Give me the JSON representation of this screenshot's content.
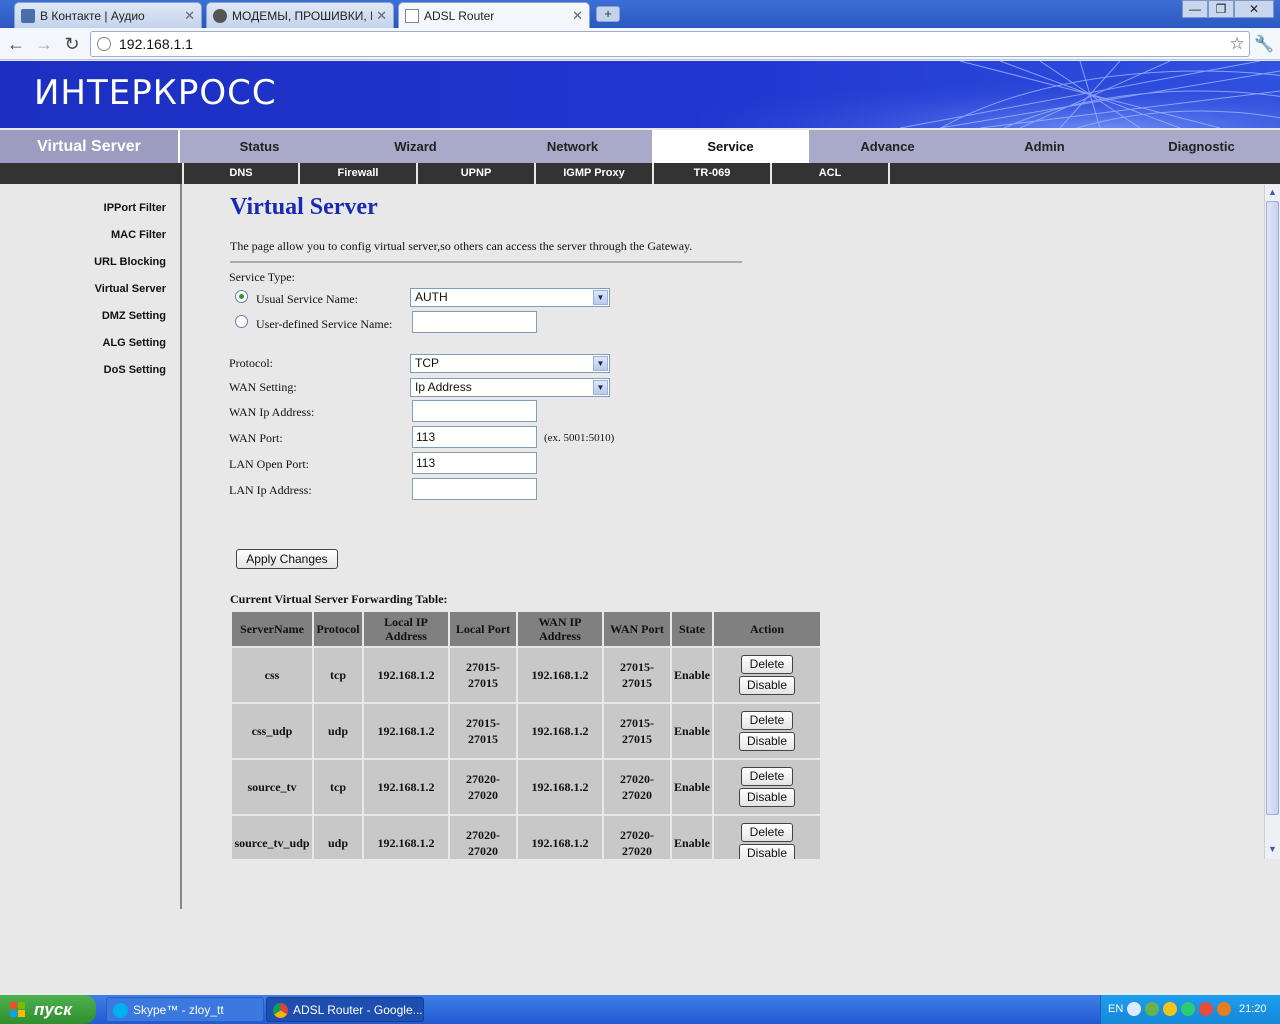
{
  "browser": {
    "tabs": [
      {
        "label": "В Контакте | Аудио",
        "active": false
      },
      {
        "label": "МОДЕМЫ, ПРОШИВКИ, И...",
        "active": false
      },
      {
        "label": "ADSL Router",
        "active": true
      }
    ],
    "url": "192.168.1.1"
  },
  "router": {
    "logo": "ИНТЕРКРОСС",
    "section_title": "Virtual Server",
    "main_menu": [
      "Status",
      "Wizard",
      "Network",
      "Service",
      "Advance",
      "Admin",
      "Diagnostic"
    ],
    "main_menu_active": "Service",
    "sub_menu": [
      "DNS",
      "Firewall",
      "UPNP",
      "IGMP Proxy",
      "TR-069",
      "ACL"
    ],
    "sidebar": [
      "IPPort Filter",
      "MAC Filter",
      "URL Blocking",
      "Virtual Server",
      "DMZ Setting",
      "ALG Setting",
      "DoS Setting"
    ]
  },
  "form": {
    "title": "Virtual Server",
    "description": "The page allow you to config virtual server,so others can access the server through the Gateway.",
    "service_type_label": "Service Type:",
    "usual_service_label": "Usual Service Name:",
    "usual_service_value": "AUTH",
    "user_defined_label": "User-defined Service Name:",
    "user_defined_value": "",
    "protocol_label": "Protocol:",
    "protocol_value": "TCP",
    "wan_setting_label": "WAN Setting:",
    "wan_setting_value": "Ip Address",
    "wan_ip_label": "WAN Ip Address:",
    "wan_ip_value": "",
    "wan_port_label": "WAN Port:",
    "wan_port_value": "113",
    "wan_port_hint": "(ex. 5001:5010)",
    "lan_port_label": "LAN Open Port:",
    "lan_port_value": "113",
    "lan_ip_label": "LAN Ip Address:",
    "lan_ip_value": "",
    "apply_label": "Apply Changes"
  },
  "table": {
    "title": "Current Virtual Server Forwarding Table:",
    "headers": [
      "ServerName",
      "Protocol",
      "Local IP Address",
      "Local Port",
      "WAN IP Address",
      "WAN Port",
      "State",
      "Action"
    ],
    "rows": [
      {
        "name": "css",
        "protocol": "tcp",
        "local_ip": "192.168.1.2",
        "local_port": "27015-27015",
        "wan_ip": "192.168.1.2",
        "wan_port": "27015-27015",
        "state": "Enable"
      },
      {
        "name": "css_udp",
        "protocol": "udp",
        "local_ip": "192.168.1.2",
        "local_port": "27015-27015",
        "wan_ip": "192.168.1.2",
        "wan_port": "27015-27015",
        "state": "Enable"
      },
      {
        "name": "source_tv",
        "protocol": "tcp",
        "local_ip": "192.168.1.2",
        "local_port": "27020-27020",
        "wan_ip": "192.168.1.2",
        "wan_port": "27020-27020",
        "state": "Enable"
      },
      {
        "name": "source_tv_udp",
        "protocol": "udp",
        "local_ip": "192.168.1.2",
        "local_port": "27020-27020",
        "wan_ip": "192.168.1.2",
        "wan_port": "27020-27020",
        "state": "Enable"
      }
    ],
    "delete_label": "Delete",
    "disable_label": "Disable"
  },
  "taskbar": {
    "start_label": "пуск",
    "tasks": [
      "Skype™ - zloy_tt",
      "ADSL Router - Google..."
    ],
    "lang": "EN",
    "clock": "21:20"
  }
}
